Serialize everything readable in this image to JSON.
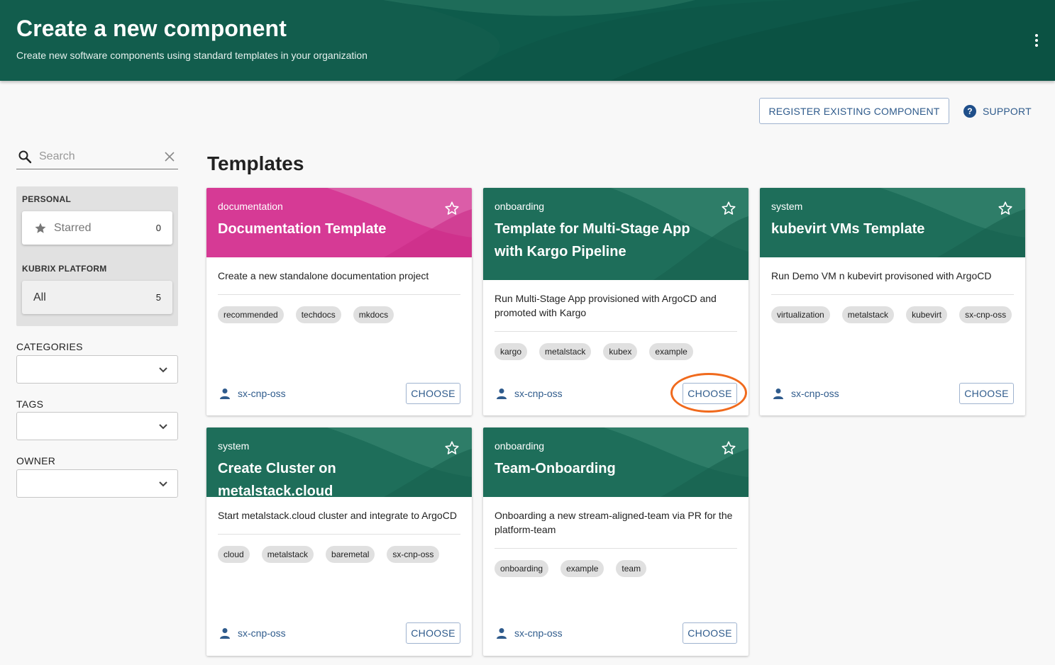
{
  "header": {
    "title": "Create a new component",
    "subtitle": "Create new software components using standard templates in your organization",
    "menu_icon": "more-vertical-icon",
    "color": "#0e5b4b"
  },
  "actions": {
    "register_label": "REGISTER EXISTING COMPONENT",
    "support_label": "SUPPORT",
    "support_icon": "help-circle-icon"
  },
  "sidebar": {
    "search_placeholder": "Search",
    "personal_label": "PERSONAL",
    "starred_label": "Starred",
    "starred_count": "0",
    "platform_label": "KUBRIX PLATFORM",
    "all_label": "All",
    "all_count": "5",
    "categories_label": "CATEGORIES",
    "tags_label": "TAGS",
    "owner_label": "OWNER"
  },
  "main": {
    "title": "Templates"
  },
  "cards": [
    {
      "type": "documentation",
      "title": "Documentation Template",
      "description": "Create a new standalone documentation project",
      "tags": [
        "recommended",
        "techdocs",
        "mkdocs"
      ],
      "owner": "sx-cnp-oss",
      "choose_label": "CHOOSE",
      "theme": "#d63a95"
    },
    {
      "type": "onboarding",
      "title": "Template for Multi-Stage App with Kargo Pipeline",
      "description": "Run Multi-Stage App provisioned with ArgoCD and promoted with Kargo",
      "tags": [
        "kargo",
        "metalstack",
        "kubex",
        "example"
      ],
      "owner": "sx-cnp-oss",
      "choose_label": "CHOOSE",
      "theme": "#1e6e5a"
    },
    {
      "type": "system",
      "title": "kubevirt VMs Template",
      "description": "Run Demo VM n kubevirt provisoned with ArgoCD",
      "tags": [
        "virtualization",
        "metalstack",
        "kubevirt",
        "sx-cnp-oss"
      ],
      "owner": "sx-cnp-oss",
      "choose_label": "CHOOSE",
      "theme": "#1e6e5a"
    },
    {
      "type": "system",
      "title": "Create Cluster on metalstack.cloud",
      "description": "Start metalstack.cloud cluster and integrate to ArgoCD",
      "tags": [
        "cloud",
        "metalstack",
        "baremetal",
        "sx-cnp-oss"
      ],
      "owner": "sx-cnp-oss",
      "choose_label": "CHOOSE",
      "theme": "#1e6e5a"
    },
    {
      "type": "onboarding",
      "title": "Team-Onboarding",
      "description": "Onboarding a new stream-aligned-team via PR for the platform-team",
      "tags": [
        "onboarding",
        "example",
        "team"
      ],
      "owner": "sx-cnp-oss",
      "choose_label": "CHOOSE",
      "theme": "#1e6e5a"
    }
  ],
  "annotation": {
    "highlight_color": "#f06a1d"
  }
}
